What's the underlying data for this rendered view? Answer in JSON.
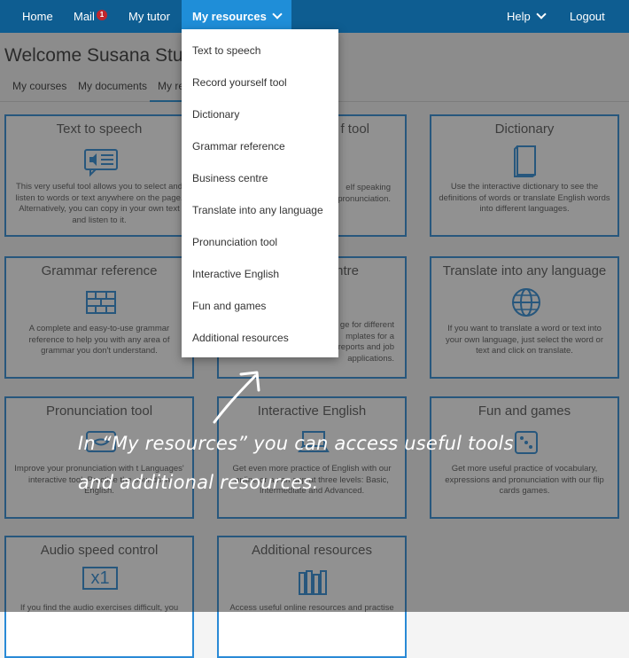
{
  "nav": {
    "home": "Home",
    "mail": "Mail",
    "mail_badge": "1",
    "my_tutor": "My tutor",
    "my_resources": "My resources",
    "help": "Help",
    "logout": "Logout"
  },
  "welcome": "Welcome Susana Stude",
  "subtabs": {
    "my_courses": "My courses",
    "my_documents": "My documents",
    "my_resources_partial": "My re"
  },
  "cards": [
    {
      "title": "Text to speech",
      "icon": "speaker-text-icon",
      "desc": "This very useful tool allows you to select and listen to words or text anywhere on the page. Alternatively, you can copy in your own text and listen to it."
    },
    {
      "title": "Record yourself tool",
      "title_partial": "f tool",
      "icon": "microphone-icon",
      "desc_partial": "elf speaking\npronunciation."
    },
    {
      "title": "Dictionary",
      "icon": "book-icon",
      "desc": "Use the interactive dictionary to see the definitions of words or translate English words into different languages."
    },
    {
      "title": "Grammar reference",
      "icon": "bricks-icon",
      "desc": "A complete and easy-to-use grammar reference to help you with any area of grammar you don't understand."
    },
    {
      "title": "Business centre",
      "title_partial": "ntre",
      "icon": "briefcase-icon",
      "desc_partial": "ge for different\nmplates for a\nreports and job\napplications."
    },
    {
      "title": "Translate into any language",
      "icon": "globe-icon",
      "desc": "If you want to translate a word or text into your own language, just select the word or text and click on translate."
    },
    {
      "title": "Pronunciation tool",
      "icon": "mouth-icon",
      "desc": "Improve your pronunciation with t Languages' interactive tool. Practise the sounds in English."
    },
    {
      "title": "Interactive English",
      "icon": "laptop-icon",
      "desc": "Get even more practice of English with our online or as an app at three levels: Basic, Intermediate and Advanced."
    },
    {
      "title": "Fun and games",
      "icon": "dice-icon",
      "desc": "Get more useful practice of vocabulary, expressions and pronunciation with our flip cards games."
    },
    {
      "title": "Audio speed control",
      "icon": "speed-x1-icon",
      "icon_text": "x1",
      "desc": "If you find the audio exercises difficult, you"
    },
    {
      "title": "Additional resources",
      "icon": "books-icon",
      "desc": "Access useful online resources and practise"
    }
  ],
  "dropdown": [
    "Text to speech",
    "Record yourself tool",
    "Dictionary",
    "Grammar reference",
    "Business centre",
    "Translate into any language",
    "Pronunciation tool",
    "Interactive English",
    "Fun and games",
    "Additional resources"
  ],
  "callout": {
    "line1": "In “My resources” you can access useful tools",
    "line2": "and additional resources."
  },
  "colors": {
    "nav_bg": "#0e5d91",
    "nav_active": "#1f8ed8",
    "card_border": "#2a8ad6",
    "badge": "#c0262d"
  }
}
